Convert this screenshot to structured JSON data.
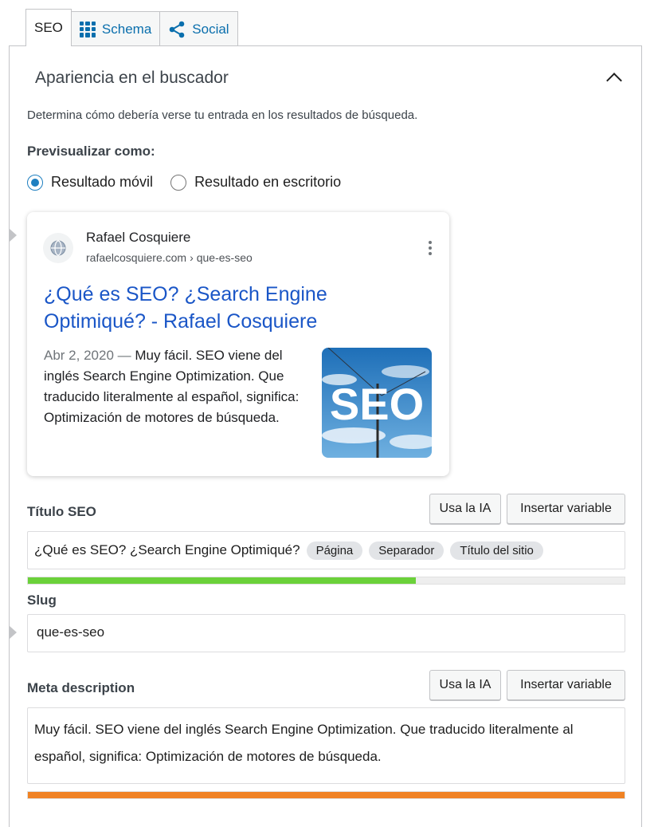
{
  "tabs": {
    "seo": "SEO",
    "schema": "Schema",
    "social": "Social"
  },
  "panel": {
    "title": "Apariencia en el buscador",
    "description": "Determina cómo debería verse tu entrada en los resultados de búsqueda.",
    "preview_label": "Previsualizar como:",
    "radio_mobile": "Resultado móvil",
    "radio_desktop": "Resultado en escritorio",
    "selected_preview": "mobile"
  },
  "preview": {
    "site_name": "Rafael Cosquiere",
    "domain": "rafaelcosquiere.com",
    "crumb_separator": "›",
    "path": "que-es-seo",
    "title": "¿Qué es SEO? ¿Search Engine Optimiqué? - Rafael Cosquiere",
    "date": "Abr 2, 2020",
    "date_separator": "—",
    "snippet": "Muy fácil. SEO viene del inglés Search Engine Optimization. Que traducido literalmente al español, significa: Optimización de motores de búsqueda.",
    "thumbnail_text": "SEO"
  },
  "seo_title": {
    "label": "Título SEO",
    "ai_button": "Usa la IA",
    "insert_button": "Insertar variable",
    "text": "¿Qué es SEO? ¿Search Engine Optimiqué?",
    "chips": [
      "Página",
      "Separador",
      "Título del sitio"
    ],
    "progress": 0.65,
    "progress_color": "#6bd13a"
  },
  "slug": {
    "label": "Slug",
    "value": "que-es-seo"
  },
  "meta_description": {
    "label": "Meta description",
    "ai_button": "Usa la IA",
    "insert_button": "Insertar variable",
    "value": "Muy fácil. SEO viene del inglés Search Engine Optimization. Que traducido literalmente al español, significa: Optimización de motores de búsqueda.",
    "progress": 1.0,
    "progress_color": "#f08223"
  },
  "colors": {
    "link_blue": "#1a56c7",
    "tab_blue": "#0a6fad",
    "radio_blue": "#1e7fc0"
  }
}
